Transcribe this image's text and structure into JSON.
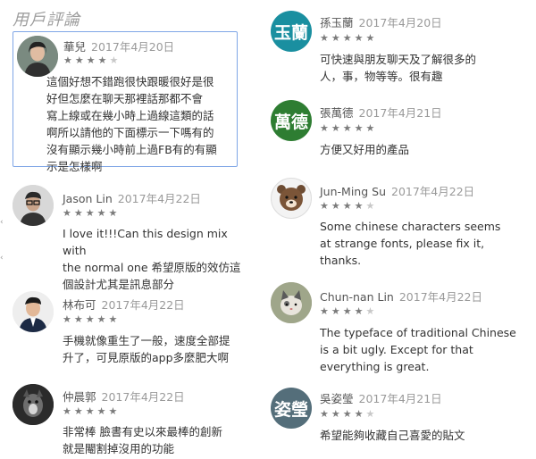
{
  "section_title": "用戶評論",
  "reviews_left": [
    {
      "author": "華兒",
      "date": "2017年4月20日",
      "rating": 4,
      "avatar": "photo-woman-icon",
      "lines": [
        "這個好想不錯跑很快跟暖很好是很",
        "好但怎麼在聊天那裡話那都不會",
        "寫上線或在幾小時上過線這類的話",
        "啊所以請他的下面標示一下嗎有的",
        "沒有顯示幾小時前上過FB有的有顯",
        "示是怎樣啊"
      ]
    },
    {
      "author": "Jason Lin",
      "date": "2017年4月22日",
      "rating": 5,
      "avatar": "photo-man-glasses-icon",
      "lines": [
        "I love it!!!Can this design mix with",
        "the normal one 希望原版的效仿這",
        "個設計尤其是訊息部分"
      ]
    },
    {
      "author": "林布可",
      "date": "2017年4月22日",
      "rating": 5,
      "avatar": "photo-man-suit-icon",
      "lines": [
        "手機就像重生了一般，速度全部提",
        "升了，可見原版的app多麼肥大啊"
      ]
    },
    {
      "author": "仲晨郭",
      "date": "2017年4月22日",
      "rating": 5,
      "avatar": "photo-dog-icon",
      "lines": [
        "非常棒 臉書有史以來最棒的創新",
        "就是閹割掉沒用的功能"
      ]
    }
  ],
  "reviews_right": [
    {
      "author": "孫玉蘭",
      "date": "2017年4月20日",
      "rating": 5,
      "avatar_text": "玉蘭",
      "avatar_color": "#1a8fa0",
      "lines": [
        "可快速與朋友聊天及了解很多的",
        "人，事，物等等。很有趣"
      ]
    },
    {
      "author": "張萬德",
      "date": "2017年4月21日",
      "rating": 5,
      "avatar_text": "萬德",
      "avatar_color": "#2e7d32",
      "lines": [
        "方便又好用的產品"
      ]
    },
    {
      "author": "Jun-Ming Su",
      "date": "2017年4月22日",
      "rating": 4,
      "avatar": "bear-icon",
      "lines": [
        "Some chinese characters seems",
        "at strange fonts, please fix it,",
        "thanks."
      ]
    },
    {
      "author": "Chun-nan Lin",
      "date": "2017年4月22日",
      "rating": 4,
      "avatar": "photo-cat-icon",
      "lines": [
        "The typeface of traditional Chinese",
        "is a bit ugly. Except for that",
        "everything is great."
      ]
    },
    {
      "author": "吳姿瑩",
      "date": "2017年4月21日",
      "rating": 4,
      "avatar_text": "姿瑩",
      "avatar_color": "#546e7a",
      "lines": [
        "希望能夠收藏自己喜愛的貼文"
      ]
    }
  ]
}
